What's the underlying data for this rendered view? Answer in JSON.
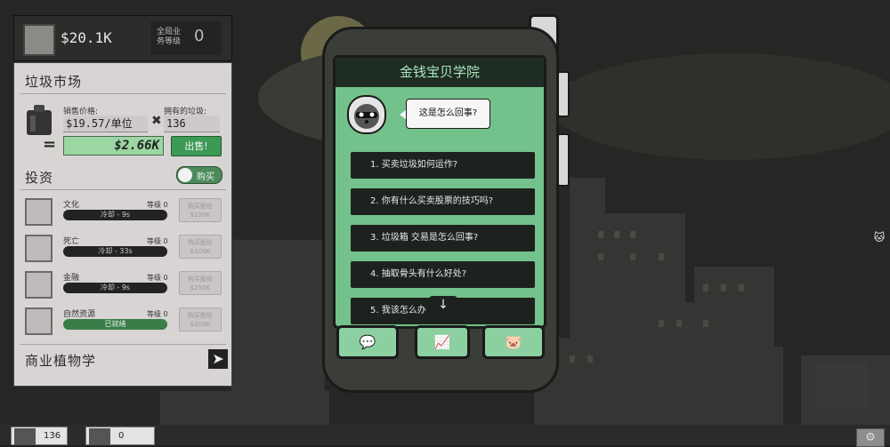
{
  "header": {
    "money": "$20.1K",
    "global_label": "全局业务等级",
    "global_count": "0"
  },
  "trash_market": {
    "title": "垃圾市场",
    "price_label": "销售价格:",
    "price_value": "$19.57/单位",
    "owned_label": "拥有的垃圾:",
    "owned_value": "136",
    "multiply": "✖",
    "equals": "=",
    "total": "$2.66K",
    "sell_button": "出售!"
  },
  "invest": {
    "title": "投资",
    "buy_toggle": "购买",
    "items": [
      {
        "name": "文化",
        "level": "等级 0",
        "status": "冷却 - 9s",
        "buy": "购买股份",
        "price": "$150K",
        "ready": false
      },
      {
        "name": "死亡",
        "level": "等级 0",
        "status": "冷却 - 33s",
        "buy": "购买股份",
        "price": "$100K",
        "ready": false
      },
      {
        "name": "金融",
        "level": "等级 0",
        "status": "冷却 - 9s",
        "buy": "购买股份",
        "price": "$250K",
        "ready": false
      },
      {
        "name": "自然资源",
        "level": "等级 0",
        "status": "已就绪",
        "buy": "购买股份",
        "price": "$200K",
        "ready": true
      }
    ]
  },
  "botany": {
    "title": "商业植物学",
    "arrow": "➤"
  },
  "phone": {
    "title": "金钱宝贝学院",
    "bubble": "这是怎么回事?",
    "questions": [
      "1. 买卖垃圾如何运作?",
      "2. 你有什么买卖股票的技巧吗?",
      "3. 垃圾箱 交易是怎么回事?",
      "4. 抽取骨头有什么好处?",
      "5. 我该怎么办"
    ],
    "scroll_arrow": "↓",
    "nav_icons": [
      "chat-icon",
      "chart-icon",
      "pig-icon"
    ]
  },
  "bottom_bar": {
    "trash_count": "136",
    "bone_count": "0"
  },
  "colors": {
    "accent_green": "#73c18b",
    "dark": "#1d221f",
    "panel": "#d9d4d4"
  }
}
